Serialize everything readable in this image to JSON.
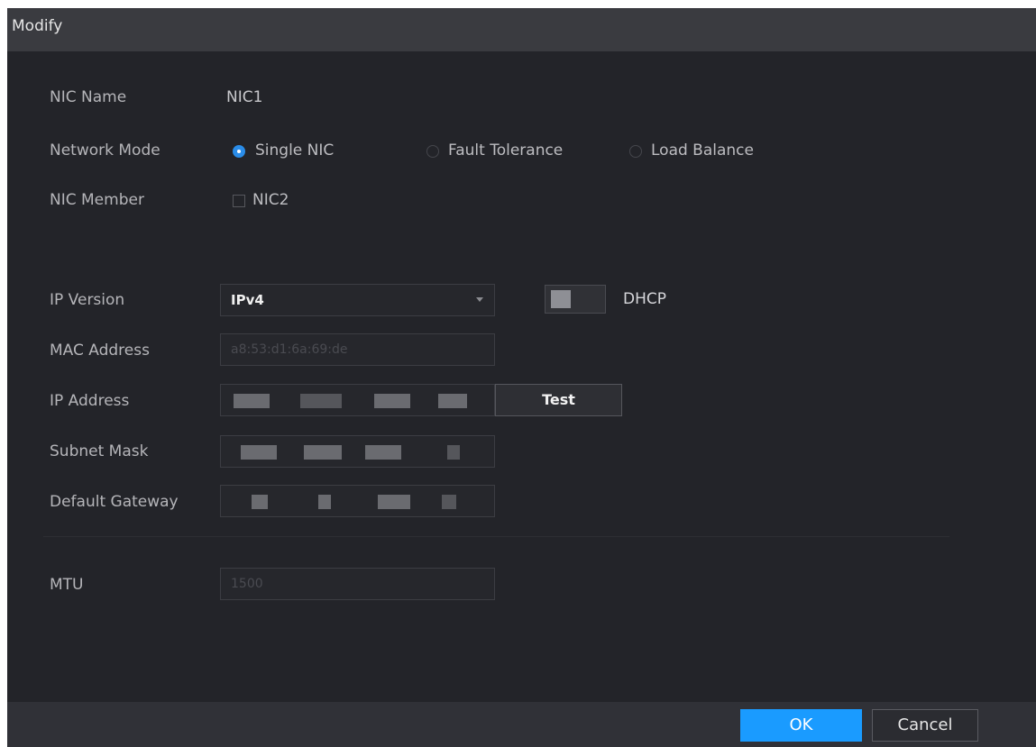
{
  "dialog": {
    "title": "Modify",
    "ok_label": "OK",
    "cancel_label": "Cancel"
  },
  "nic": {
    "name_label": "NIC Name",
    "name_value": "NIC1",
    "network_mode_label": "Network Mode",
    "modes": [
      {
        "label": "Single NIC",
        "selected": true
      },
      {
        "label": "Fault Tolerance",
        "selected": false
      },
      {
        "label": "Load Balance",
        "selected": false
      }
    ],
    "member_label": "NIC Member",
    "member_option": "NIC2"
  },
  "ip": {
    "version_label": "IP Version",
    "version_value": "IPv4",
    "dhcp_label": "DHCP",
    "mac_label": "MAC Address",
    "mac_value": "a8:53:d1:6a:69:de",
    "address_label": "IP Address",
    "test_label": "Test",
    "subnet_label": "Subnet Mask",
    "gateway_label": "Default Gateway",
    "mtu_label": "MTU",
    "mtu_value": "1500"
  },
  "colors": {
    "accent": "#1a9bff",
    "radio_selected": "#2a8ce8",
    "background": "#232429",
    "titlebar": "#3a3b40"
  }
}
